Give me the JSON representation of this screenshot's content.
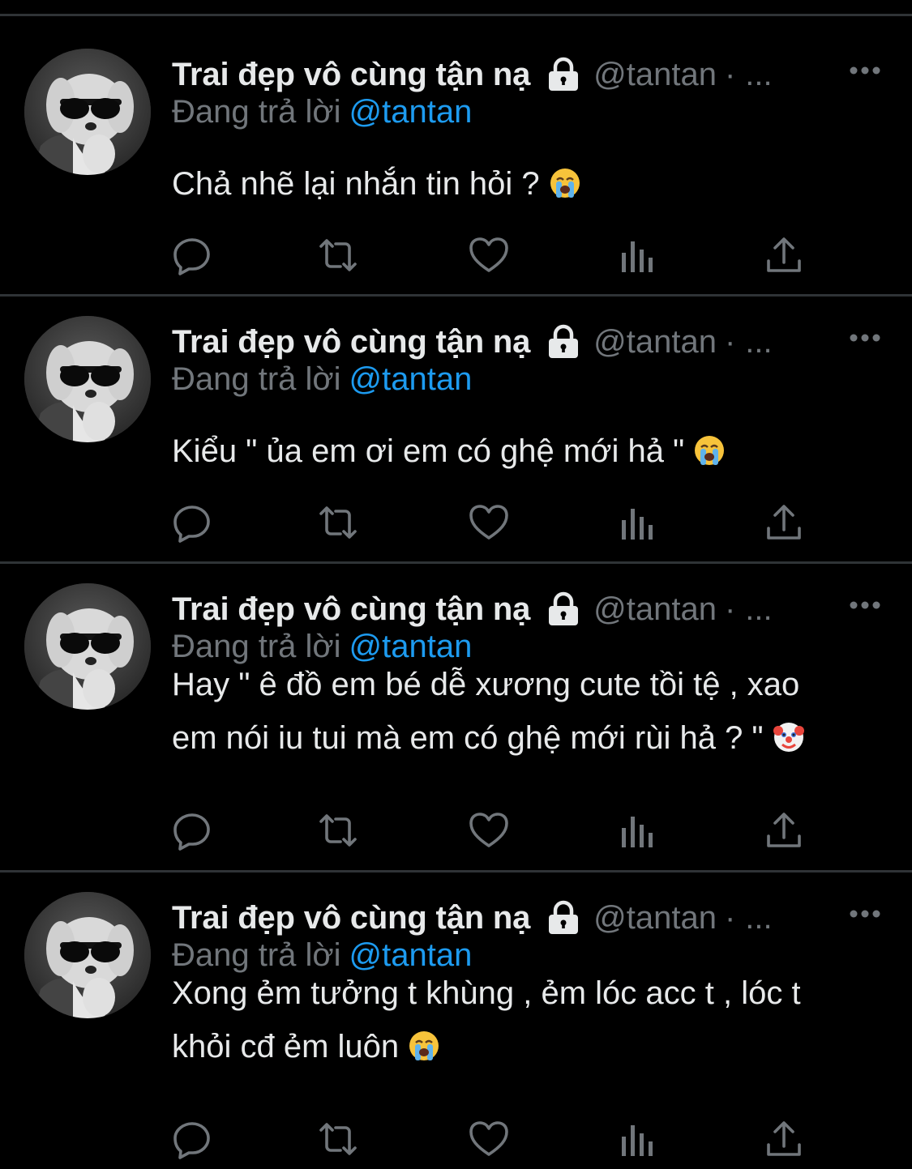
{
  "colors": {
    "background": "#000000",
    "divider": "#2f3336",
    "text_primary": "#e7e9ea",
    "text_secondary": "#71767b",
    "link": "#1d9bf0"
  },
  "tweets": [
    {
      "display_name": "Trai đẹp vô cùng tận nạ",
      "handle": "@tantan",
      "separator": "·",
      "ellipsis": "...",
      "reply_label": "Đang trả lời",
      "reply_to": "@tantan",
      "lines": [
        "Chả nhẽ lại nhắn tin hỏi ?"
      ],
      "emoji": "loudly-crying-face-emoji"
    },
    {
      "display_name": "Trai đẹp vô cùng tận nạ",
      "handle": "@tantan",
      "separator": "·",
      "ellipsis": "...",
      "reply_label": "Đang trả lời",
      "reply_to": "@tantan",
      "lines": [
        "Kiểu \" ủa em ơi em có ghệ mới hả \""
      ],
      "emoji": "loudly-crying-face-emoji"
    },
    {
      "display_name": "Trai đẹp vô cùng tận nạ",
      "handle": "@tantan",
      "separator": "·",
      "ellipsis": "...",
      "reply_label": "Đang trả lời",
      "reply_to": "@tantan",
      "lines": [
        "Hay \" ê đồ em bé dễ xương cute tồi tệ , xao",
        "em nói iu tui mà em có ghệ mới rùi hả ? \""
      ],
      "emoji": "clown-face-emoji"
    },
    {
      "display_name": "Trai đẹp vô cùng tận nạ",
      "handle": "@tantan",
      "separator": "·",
      "ellipsis": "...",
      "reply_label": "Đang trả lời",
      "reply_to": "@tantan",
      "lines": [
        "Xong ẻm tưởng t khùng , ẻm lóc acc t , lóc t",
        "khỏi cđ ẻm luôn"
      ],
      "emoji": "loudly-crying-face-emoji"
    }
  ],
  "action_icons": [
    "reply-icon",
    "retweet-icon",
    "like-icon",
    "views-icon",
    "share-icon"
  ]
}
